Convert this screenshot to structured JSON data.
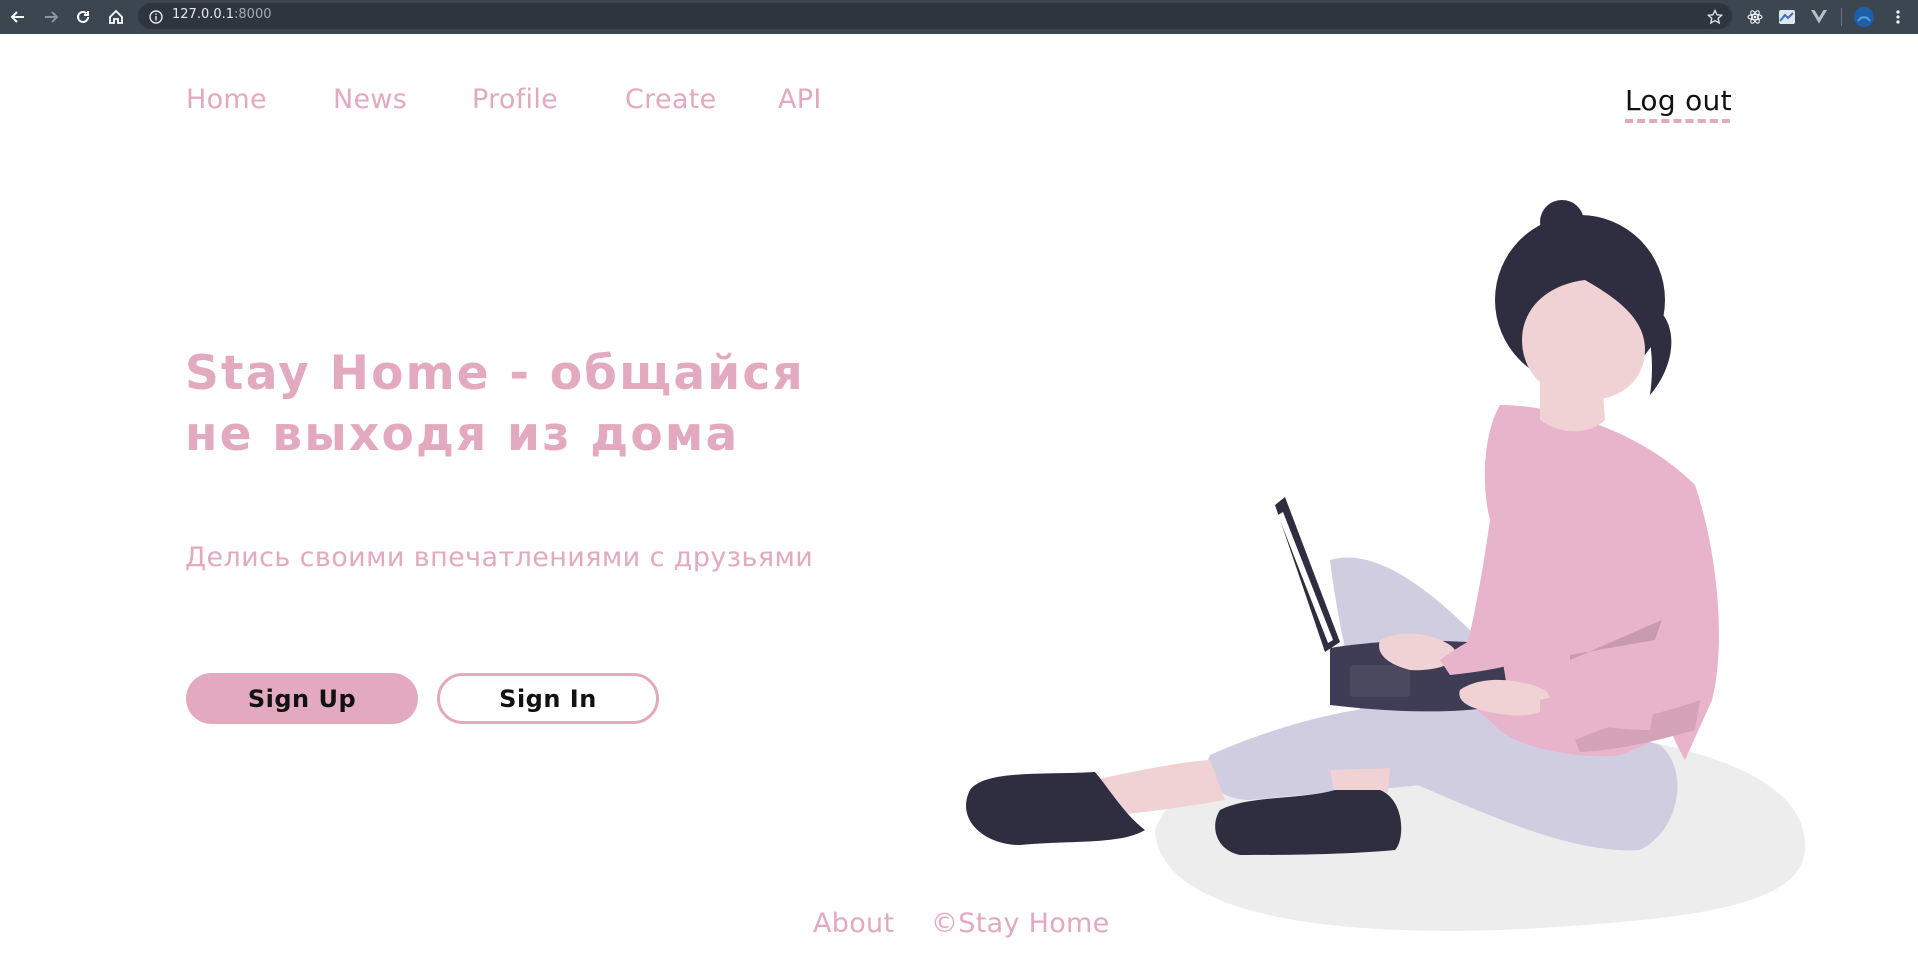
{
  "browser": {
    "url_host": "127.0.0.1",
    "url_port": ":8000",
    "icons": [
      "back-arrow-icon",
      "forward-arrow-icon",
      "reload-icon",
      "home-icon",
      "info-icon",
      "star-icon",
      "react-devtools-icon",
      "extension-icon",
      "vue-devtools-icon",
      "profile-avatar-icon",
      "more-menu-icon"
    ]
  },
  "nav": {
    "items": [
      {
        "label": "Home"
      },
      {
        "label": "News"
      },
      {
        "label": "Profile"
      },
      {
        "label": "Create"
      },
      {
        "label": "API"
      }
    ],
    "logout_label": "Log out"
  },
  "hero": {
    "title_line1": "Stay Home - общайся",
    "title_line2": "не выходя из дома",
    "subtitle": "Делись своими впечатлениями с друзьями",
    "signup_label": "Sign Up",
    "signin_label": "Sign In"
  },
  "footer": {
    "about_label": "About",
    "copyright": "©Stay Home"
  },
  "colors": {
    "accent": "#e2a9bf",
    "chrome": "#3c4650",
    "hair": "#2f2e41",
    "skin": "#f0d1d4",
    "sweater": "#e8b4cb",
    "pants": "#d0cde1",
    "shadow": "#ededed"
  }
}
